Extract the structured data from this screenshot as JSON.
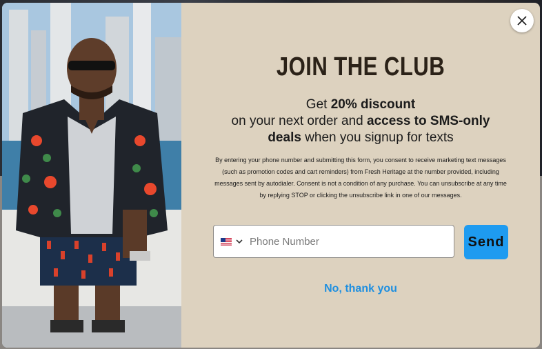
{
  "modal": {
    "close_icon": "close-icon",
    "headline": "JOIN THE CLUB",
    "offer": {
      "get": "Get",
      "discount": "20% discount",
      "next_order": "on your next order and",
      "access": "access to SMS-only",
      "deals": "deals",
      "signup": "when you signup for texts"
    },
    "legal": "By entering your phone number and submitting this form, you consent to receive marketing text messages (such as promotion codes and cart reminders) from Fresh Heritage at the number provided, including messages sent by autodialer. Consent is not a condition of any purchase. You can unsubscribe at any time by replying STOP or clicking the unsubscribe link in one of our messages.",
    "phone": {
      "placeholder": "Phone Number",
      "value": "",
      "country_flag": "us-flag-icon"
    },
    "send_label": "Send",
    "decline_label": "No, thank you"
  },
  "colors": {
    "modal_bg": "#ddd2bf",
    "accent": "#1e9bf0",
    "headline": "#2b2218"
  }
}
